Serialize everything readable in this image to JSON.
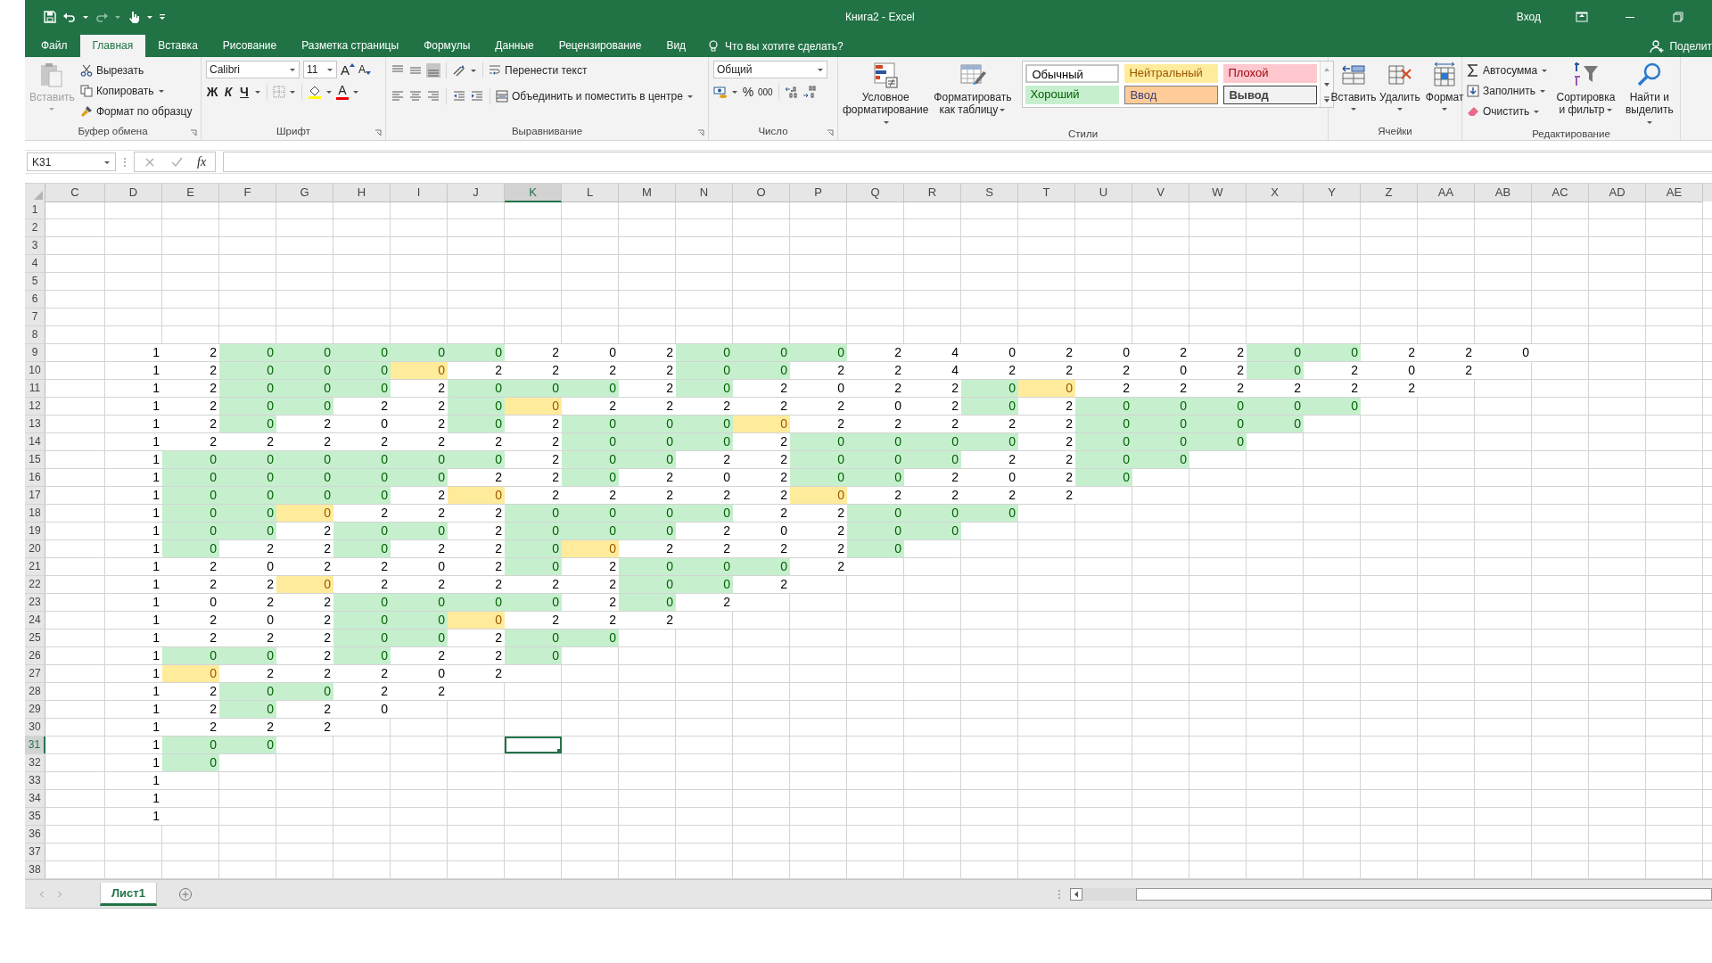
{
  "title_bar": {
    "title": "Книга2  -  Excel",
    "sign_in": "Вход"
  },
  "ribbon_tabs": [
    {
      "label": "Файл",
      "selected": false
    },
    {
      "label": "Главная",
      "selected": true
    },
    {
      "label": "Вставка",
      "selected": false
    },
    {
      "label": "Рисование",
      "selected": false
    },
    {
      "label": "Разметка страницы",
      "selected": false
    },
    {
      "label": "Формулы",
      "selected": false
    },
    {
      "label": "Данные",
      "selected": false
    },
    {
      "label": "Рецензирование",
      "selected": false
    },
    {
      "label": "Вид",
      "selected": false
    }
  ],
  "tell_me": "Что вы хотите сделать?",
  "share": "Поделит",
  "clipboard": {
    "paste": {
      "label": "Вставить",
      "disabled": true
    },
    "cut": "Вырезать",
    "copy": "Копировать",
    "format_painter": "Формат по образцу",
    "group_label": "Буфер обмена"
  },
  "font": {
    "name": "Calibri",
    "size": "11",
    "grow": "A",
    "shrink": "A",
    "bold": "Ж",
    "italic": "К",
    "underline": "Ч",
    "font_color_label": "A",
    "group_label": "Шрифт"
  },
  "alignment": {
    "wrap_text": "Перенести текст",
    "merge": "Объединить и поместить в центре",
    "group_label": "Выравнивание"
  },
  "number": {
    "format": "Общий",
    "percent": "%",
    "thousands": "000",
    "group_label": "Число"
  },
  "styles": {
    "conditional": "Условное форматирование",
    "format_table": "Форматировать как таблицу",
    "group_label": "Стили",
    "gallery": [
      {
        "label": "Обычный",
        "kind": "normal"
      },
      {
        "label": "Нейтральный",
        "kind": "neutral"
      },
      {
        "label": "Плохой",
        "kind": "bad"
      },
      {
        "label": "Хороший",
        "kind": "good"
      },
      {
        "label": "Ввод",
        "kind": "input"
      },
      {
        "label": "Вывод",
        "kind": "output"
      }
    ]
  },
  "cells_group": {
    "insert": "Вставить",
    "delete": "Удалить",
    "format": "Формат",
    "group_label": "Ячейки"
  },
  "editing": {
    "autosum": "Автосумма",
    "fill": "Заполнить",
    "clear": "Очистить",
    "sort_filter": "Сортировка и фильтр",
    "find_select": "Найти и выделить",
    "group_label": "Редактирование"
  },
  "formula_bar": {
    "name_box": "K31",
    "function_label": "fx"
  },
  "sheet": {
    "columns": [
      {
        "label": "C",
        "selected": false
      },
      {
        "label": "D",
        "selected": false
      },
      {
        "label": "E",
        "selected": false
      },
      {
        "label": "F",
        "selected": false
      },
      {
        "label": "G",
        "selected": false
      },
      {
        "label": "H",
        "selected": false
      },
      {
        "label": "I",
        "selected": false
      },
      {
        "label": "J",
        "selected": false
      },
      {
        "label": "K",
        "selected": true
      },
      {
        "label": "L",
        "selected": false
      },
      {
        "label": "M",
        "selected": false
      },
      {
        "label": "N",
        "selected": false
      },
      {
        "label": "O",
        "selected": false
      },
      {
        "label": "P",
        "selected": false
      },
      {
        "label": "Q",
        "selected": false
      },
      {
        "label": "R",
        "selected": false
      },
      {
        "label": "S",
        "selected": false
      },
      {
        "label": "T",
        "selected": false
      },
      {
        "label": "U",
        "selected": false
      },
      {
        "label": "V",
        "selected": false
      },
      {
        "label": "W",
        "selected": false
      },
      {
        "label": "X",
        "selected": false
      },
      {
        "label": "Y",
        "selected": false
      },
      {
        "label": "Z",
        "selected": false
      },
      {
        "label": "AA",
        "selected": false
      },
      {
        "label": "AB",
        "selected": false
      },
      {
        "label": "AC",
        "selected": false
      },
      {
        "label": "AD",
        "selected": false
      },
      {
        "label": "AE",
        "selected": false
      }
    ],
    "rows": [
      {
        "header": "1",
        "selected": false
      },
      {
        "header": "2",
        "selected": false
      },
      {
        "header": "3",
        "selected": false
      },
      {
        "header": "4",
        "selected": false
      },
      {
        "header": "5",
        "selected": false
      },
      {
        "header": "6",
        "selected": false
      },
      {
        "header": "7",
        "selected": false
      },
      {
        "header": "8",
        "selected": false
      },
      {
        "header": "9",
        "selected": false,
        "cells": [
          {
            "value": "1",
            "kind": "plain"
          },
          {
            "value": "2",
            "kind": "plain"
          },
          {
            "value": "0",
            "kind": "good"
          },
          {
            "value": "0",
            "kind": "good"
          },
          {
            "value": "0",
            "kind": "good"
          },
          {
            "value": "0",
            "kind": "good"
          },
          {
            "value": "0",
            "kind": "good"
          },
          {
            "value": "2",
            "kind": "plain"
          },
          {
            "value": "0",
            "kind": "plain"
          },
          {
            "value": "2",
            "kind": "plain"
          },
          {
            "value": "0",
            "kind": "good"
          },
          {
            "value": "0",
            "kind": "good"
          },
          {
            "value": "0",
            "kind": "good"
          },
          {
            "value": "2",
            "kind": "plain"
          },
          {
            "value": "4",
            "kind": "plain"
          },
          {
            "value": "0",
            "kind": "plain"
          },
          {
            "value": "2",
            "kind": "plain"
          },
          {
            "value": "0",
            "kind": "plain"
          },
          {
            "value": "2",
            "kind": "plain"
          },
          {
            "value": "2",
            "kind": "plain"
          },
          {
            "value": "0",
            "kind": "good"
          },
          {
            "value": "0",
            "kind": "good"
          },
          {
            "value": "2",
            "kind": "plain"
          },
          {
            "value": "2",
            "kind": "plain"
          },
          {
            "value": "0",
            "kind": "plain"
          }
        ]
      },
      {
        "header": "10",
        "selected": false,
        "cells": [
          {
            "value": "1",
            "kind": "plain"
          },
          {
            "value": "2",
            "kind": "plain"
          },
          {
            "value": "0",
            "kind": "good"
          },
          {
            "value": "0",
            "kind": "good"
          },
          {
            "value": "0",
            "kind": "good"
          },
          {
            "value": "0",
            "kind": "neutral"
          },
          {
            "value": "2",
            "kind": "plain"
          },
          {
            "value": "2",
            "kind": "plain"
          },
          {
            "value": "2",
            "kind": "plain"
          },
          {
            "value": "2",
            "kind": "plain"
          },
          {
            "value": "0",
            "kind": "good"
          },
          {
            "value": "0",
            "kind": "good"
          },
          {
            "value": "2",
            "kind": "plain"
          },
          {
            "value": "2",
            "kind": "plain"
          },
          {
            "value": "4",
            "kind": "plain"
          },
          {
            "value": "2",
            "kind": "plain"
          },
          {
            "value": "2",
            "kind": "plain"
          },
          {
            "value": "2",
            "kind": "plain"
          },
          {
            "value": "0",
            "kind": "plain"
          },
          {
            "value": "2",
            "kind": "plain"
          },
          {
            "value": "0",
            "kind": "good"
          },
          {
            "value": "2",
            "kind": "plain"
          },
          {
            "value": "0",
            "kind": "plain"
          },
          {
            "value": "2",
            "kind": "plain"
          }
        ]
      },
      {
        "header": "11",
        "selected": false,
        "cells": [
          {
            "value": "1",
            "kind": "plain"
          },
          {
            "value": "2",
            "kind": "plain"
          },
          {
            "value": "0",
            "kind": "good"
          },
          {
            "value": "0",
            "kind": "good"
          },
          {
            "value": "0",
            "kind": "good"
          },
          {
            "value": "2",
            "kind": "plain"
          },
          {
            "value": "0",
            "kind": "good"
          },
          {
            "value": "0",
            "kind": "good"
          },
          {
            "value": "0",
            "kind": "good"
          },
          {
            "value": "2",
            "kind": "plain"
          },
          {
            "value": "0",
            "kind": "good"
          },
          {
            "value": "2",
            "kind": "plain"
          },
          {
            "value": "0",
            "kind": "plain"
          },
          {
            "value": "2",
            "kind": "plain"
          },
          {
            "value": "2",
            "kind": "plain"
          },
          {
            "value": "0",
            "kind": "good"
          },
          {
            "value": "0",
            "kind": "neutral"
          },
          {
            "value": "2",
            "kind": "plain"
          },
          {
            "value": "2",
            "kind": "plain"
          },
          {
            "value": "2",
            "kind": "plain"
          },
          {
            "value": "2",
            "kind": "plain"
          },
          {
            "value": "2",
            "kind": "plain"
          },
          {
            "value": "2",
            "kind": "plain"
          }
        ]
      },
      {
        "header": "12",
        "selected": false,
        "cells": [
          {
            "value": "1",
            "kind": "plain"
          },
          {
            "value": "2",
            "kind": "plain"
          },
          {
            "value": "0",
            "kind": "good"
          },
          {
            "value": "0",
            "kind": "good"
          },
          {
            "value": "2",
            "kind": "plain"
          },
          {
            "value": "2",
            "kind": "plain"
          },
          {
            "value": "0",
            "kind": "good"
          },
          {
            "value": "0",
            "kind": "neutral"
          },
          {
            "value": "2",
            "kind": "plain"
          },
          {
            "value": "2",
            "kind": "plain"
          },
          {
            "value": "2",
            "kind": "plain"
          },
          {
            "value": "2",
            "kind": "plain"
          },
          {
            "value": "2",
            "kind": "plain"
          },
          {
            "value": "0",
            "kind": "plain"
          },
          {
            "value": "2",
            "kind": "plain"
          },
          {
            "value": "0",
            "kind": "good"
          },
          {
            "value": "2",
            "kind": "plain"
          },
          {
            "value": "0",
            "kind": "good"
          },
          {
            "value": "0",
            "kind": "good"
          },
          {
            "value": "0",
            "kind": "good"
          },
          {
            "value": "0",
            "kind": "good"
          },
          {
            "value": "0",
            "kind": "good"
          }
        ]
      },
      {
        "header": "13",
        "selected": false,
        "cells": [
          {
            "value": "1",
            "kind": "plain"
          },
          {
            "value": "2",
            "kind": "plain"
          },
          {
            "value": "0",
            "kind": "good"
          },
          {
            "value": "2",
            "kind": "plain"
          },
          {
            "value": "0",
            "kind": "plain"
          },
          {
            "value": "2",
            "kind": "plain"
          },
          {
            "value": "0",
            "kind": "good"
          },
          {
            "value": "2",
            "kind": "plain"
          },
          {
            "value": "0",
            "kind": "good"
          },
          {
            "value": "0",
            "kind": "good"
          },
          {
            "value": "0",
            "kind": "good"
          },
          {
            "value": "0",
            "kind": "neutral"
          },
          {
            "value": "2",
            "kind": "plain"
          },
          {
            "value": "2",
            "kind": "plain"
          },
          {
            "value": "2",
            "kind": "plain"
          },
          {
            "value": "2",
            "kind": "plain"
          },
          {
            "value": "2",
            "kind": "plain"
          },
          {
            "value": "0",
            "kind": "good"
          },
          {
            "value": "0",
            "kind": "good"
          },
          {
            "value": "0",
            "kind": "good"
          },
          {
            "value": "0",
            "kind": "good"
          }
        ]
      },
      {
        "header": "14",
        "selected": false,
        "cells": [
          {
            "value": "1",
            "kind": "plain"
          },
          {
            "value": "2",
            "kind": "plain"
          },
          {
            "value": "2",
            "kind": "plain"
          },
          {
            "value": "2",
            "kind": "plain"
          },
          {
            "value": "2",
            "kind": "plain"
          },
          {
            "value": "2",
            "kind": "plain"
          },
          {
            "value": "2",
            "kind": "plain"
          },
          {
            "value": "2",
            "kind": "plain"
          },
          {
            "value": "0",
            "kind": "good"
          },
          {
            "value": "0",
            "kind": "good"
          },
          {
            "value": "0",
            "kind": "good"
          },
          {
            "value": "2",
            "kind": "plain"
          },
          {
            "value": "0",
            "kind": "good"
          },
          {
            "value": "0",
            "kind": "good"
          },
          {
            "value": "0",
            "kind": "good"
          },
          {
            "value": "0",
            "kind": "good"
          },
          {
            "value": "2",
            "kind": "plain"
          },
          {
            "value": "0",
            "kind": "good"
          },
          {
            "value": "0",
            "kind": "good"
          },
          {
            "value": "0",
            "kind": "good"
          }
        ]
      },
      {
        "header": "15",
        "selected": false,
        "cells": [
          {
            "value": "1",
            "kind": "plain"
          },
          {
            "value": "0",
            "kind": "good"
          },
          {
            "value": "0",
            "kind": "good"
          },
          {
            "value": "0",
            "kind": "good"
          },
          {
            "value": "0",
            "kind": "good"
          },
          {
            "value": "0",
            "kind": "good"
          },
          {
            "value": "0",
            "kind": "good"
          },
          {
            "value": "2",
            "kind": "plain"
          },
          {
            "value": "0",
            "kind": "good"
          },
          {
            "value": "0",
            "kind": "good"
          },
          {
            "value": "2",
            "kind": "plain"
          },
          {
            "value": "2",
            "kind": "plain"
          },
          {
            "value": "0",
            "kind": "good"
          },
          {
            "value": "0",
            "kind": "good"
          },
          {
            "value": "0",
            "kind": "good"
          },
          {
            "value": "2",
            "kind": "plain"
          },
          {
            "value": "2",
            "kind": "plain"
          },
          {
            "value": "0",
            "kind": "good"
          },
          {
            "value": "0",
            "kind": "good"
          }
        ]
      },
      {
        "header": "16",
        "selected": false,
        "cells": [
          {
            "value": "1",
            "kind": "plain"
          },
          {
            "value": "0",
            "kind": "good"
          },
          {
            "value": "0",
            "kind": "good"
          },
          {
            "value": "0",
            "kind": "good"
          },
          {
            "value": "0",
            "kind": "good"
          },
          {
            "value": "0",
            "kind": "good"
          },
          {
            "value": "2",
            "kind": "plain"
          },
          {
            "value": "2",
            "kind": "plain"
          },
          {
            "value": "0",
            "kind": "good"
          },
          {
            "value": "2",
            "kind": "plain"
          },
          {
            "value": "0",
            "kind": "plain"
          },
          {
            "value": "2",
            "kind": "plain"
          },
          {
            "value": "0",
            "kind": "good"
          },
          {
            "value": "0",
            "kind": "good"
          },
          {
            "value": "2",
            "kind": "plain"
          },
          {
            "value": "0",
            "kind": "plain"
          },
          {
            "value": "2",
            "kind": "plain"
          },
          {
            "value": "0",
            "kind": "good"
          }
        ]
      },
      {
        "header": "17",
        "selected": false,
        "cells": [
          {
            "value": "1",
            "kind": "plain"
          },
          {
            "value": "0",
            "kind": "good"
          },
          {
            "value": "0",
            "kind": "good"
          },
          {
            "value": "0",
            "kind": "good"
          },
          {
            "value": "0",
            "kind": "good"
          },
          {
            "value": "2",
            "kind": "plain"
          },
          {
            "value": "0",
            "kind": "neutral"
          },
          {
            "value": "2",
            "kind": "plain"
          },
          {
            "value": "2",
            "kind": "plain"
          },
          {
            "value": "2",
            "kind": "plain"
          },
          {
            "value": "2",
            "kind": "plain"
          },
          {
            "value": "2",
            "kind": "plain"
          },
          {
            "value": "0",
            "kind": "neutral"
          },
          {
            "value": "2",
            "kind": "plain"
          },
          {
            "value": "2",
            "kind": "plain"
          },
          {
            "value": "2",
            "kind": "plain"
          },
          {
            "value": "2",
            "kind": "plain"
          }
        ]
      },
      {
        "header": "18",
        "selected": false,
        "cells": [
          {
            "value": "1",
            "kind": "plain"
          },
          {
            "value": "0",
            "kind": "good"
          },
          {
            "value": "0",
            "kind": "good"
          },
          {
            "value": "0",
            "kind": "neutral"
          },
          {
            "value": "2",
            "kind": "plain"
          },
          {
            "value": "2",
            "kind": "plain"
          },
          {
            "value": "2",
            "kind": "plain"
          },
          {
            "value": "0",
            "kind": "good"
          },
          {
            "value": "0",
            "kind": "good"
          },
          {
            "value": "0",
            "kind": "good"
          },
          {
            "value": "0",
            "kind": "good"
          },
          {
            "value": "2",
            "kind": "plain"
          },
          {
            "value": "2",
            "kind": "plain"
          },
          {
            "value": "0",
            "kind": "good"
          },
          {
            "value": "0",
            "kind": "good"
          },
          {
            "value": "0",
            "kind": "good"
          }
        ]
      },
      {
        "header": "19",
        "selected": false,
        "cells": [
          {
            "value": "1",
            "kind": "plain"
          },
          {
            "value": "0",
            "kind": "good"
          },
          {
            "value": "0",
            "kind": "good"
          },
          {
            "value": "2",
            "kind": "plain"
          },
          {
            "value": "0",
            "kind": "good"
          },
          {
            "value": "0",
            "kind": "good"
          },
          {
            "value": "2",
            "kind": "plain"
          },
          {
            "value": "0",
            "kind": "good"
          },
          {
            "value": "0",
            "kind": "good"
          },
          {
            "value": "0",
            "kind": "good"
          },
          {
            "value": "2",
            "kind": "plain"
          },
          {
            "value": "0",
            "kind": "plain"
          },
          {
            "value": "2",
            "kind": "plain"
          },
          {
            "value": "0",
            "kind": "good"
          },
          {
            "value": "0",
            "kind": "good"
          }
        ]
      },
      {
        "header": "20",
        "selected": false,
        "cells": [
          {
            "value": "1",
            "kind": "plain"
          },
          {
            "value": "0",
            "kind": "good"
          },
          {
            "value": "2",
            "kind": "plain"
          },
          {
            "value": "2",
            "kind": "plain"
          },
          {
            "value": "0",
            "kind": "good"
          },
          {
            "value": "2",
            "kind": "plain"
          },
          {
            "value": "2",
            "kind": "plain"
          },
          {
            "value": "0",
            "kind": "good"
          },
          {
            "value": "0",
            "kind": "neutral"
          },
          {
            "value": "2",
            "kind": "plain"
          },
          {
            "value": "2",
            "kind": "plain"
          },
          {
            "value": "2",
            "kind": "plain"
          },
          {
            "value": "2",
            "kind": "plain"
          },
          {
            "value": "0",
            "kind": "good"
          }
        ]
      },
      {
        "header": "21",
        "selected": false,
        "cells": [
          {
            "value": "1",
            "kind": "plain"
          },
          {
            "value": "2",
            "kind": "plain"
          },
          {
            "value": "0",
            "kind": "plain"
          },
          {
            "value": "2",
            "kind": "plain"
          },
          {
            "value": "2",
            "kind": "plain"
          },
          {
            "value": "0",
            "kind": "plain"
          },
          {
            "value": "2",
            "kind": "plain"
          },
          {
            "value": "0",
            "kind": "good"
          },
          {
            "value": "2",
            "kind": "plain"
          },
          {
            "value": "0",
            "kind": "good"
          },
          {
            "value": "0",
            "kind": "good"
          },
          {
            "value": "0",
            "kind": "good"
          },
          {
            "value": "2",
            "kind": "plain"
          }
        ]
      },
      {
        "header": "22",
        "selected": false,
        "cells": [
          {
            "value": "1",
            "kind": "plain"
          },
          {
            "value": "2",
            "kind": "plain"
          },
          {
            "value": "2",
            "kind": "plain"
          },
          {
            "value": "0",
            "kind": "neutral"
          },
          {
            "value": "2",
            "kind": "plain"
          },
          {
            "value": "2",
            "kind": "plain"
          },
          {
            "value": "2",
            "kind": "plain"
          },
          {
            "value": "2",
            "kind": "plain"
          },
          {
            "value": "2",
            "kind": "plain"
          },
          {
            "value": "0",
            "kind": "good"
          },
          {
            "value": "0",
            "kind": "good"
          },
          {
            "value": "2",
            "kind": "plain"
          }
        ]
      },
      {
        "header": "23",
        "selected": false,
        "cells": [
          {
            "value": "1",
            "kind": "plain"
          },
          {
            "value": "0",
            "kind": "plain"
          },
          {
            "value": "2",
            "kind": "plain"
          },
          {
            "value": "2",
            "kind": "plain"
          },
          {
            "value": "0",
            "kind": "good"
          },
          {
            "value": "0",
            "kind": "good"
          },
          {
            "value": "0",
            "kind": "good"
          },
          {
            "value": "0",
            "kind": "good"
          },
          {
            "value": "2",
            "kind": "plain"
          },
          {
            "value": "0",
            "kind": "good"
          },
          {
            "value": "2",
            "kind": "plain"
          }
        ]
      },
      {
        "header": "24",
        "selected": false,
        "cells": [
          {
            "value": "1",
            "kind": "plain"
          },
          {
            "value": "2",
            "kind": "plain"
          },
          {
            "value": "0",
            "kind": "plain"
          },
          {
            "value": "2",
            "kind": "plain"
          },
          {
            "value": "0",
            "kind": "good"
          },
          {
            "value": "0",
            "kind": "good"
          },
          {
            "value": "0",
            "kind": "neutral"
          },
          {
            "value": "2",
            "kind": "plain"
          },
          {
            "value": "2",
            "kind": "plain"
          },
          {
            "value": "2",
            "kind": "plain"
          }
        ]
      },
      {
        "header": "25",
        "selected": false,
        "cells": [
          {
            "value": "1",
            "kind": "plain"
          },
          {
            "value": "2",
            "kind": "plain"
          },
          {
            "value": "2",
            "kind": "plain"
          },
          {
            "value": "2",
            "kind": "plain"
          },
          {
            "value": "0",
            "kind": "good"
          },
          {
            "value": "0",
            "kind": "good"
          },
          {
            "value": "2",
            "kind": "plain"
          },
          {
            "value": "0",
            "kind": "good"
          },
          {
            "value": "0",
            "kind": "good"
          }
        ]
      },
      {
        "header": "26",
        "selected": false,
        "cells": [
          {
            "value": "1",
            "kind": "plain"
          },
          {
            "value": "0",
            "kind": "good"
          },
          {
            "value": "0",
            "kind": "good"
          },
          {
            "value": "2",
            "kind": "plain"
          },
          {
            "value": "0",
            "kind": "good"
          },
          {
            "value": "2",
            "kind": "plain"
          },
          {
            "value": "2",
            "kind": "plain"
          },
          {
            "value": "0",
            "kind": "good"
          }
        ]
      },
      {
        "header": "27",
        "selected": false,
        "cells": [
          {
            "value": "1",
            "kind": "plain"
          },
          {
            "value": "0",
            "kind": "neutral"
          },
          {
            "value": "2",
            "kind": "plain"
          },
          {
            "value": "2",
            "kind": "plain"
          },
          {
            "value": "2",
            "kind": "plain"
          },
          {
            "value": "0",
            "kind": "plain"
          },
          {
            "value": "2",
            "kind": "plain"
          }
        ]
      },
      {
        "header": "28",
        "selected": false,
        "cells": [
          {
            "value": "1",
            "kind": "plain"
          },
          {
            "value": "2",
            "kind": "plain"
          },
          {
            "value": "0",
            "kind": "good"
          },
          {
            "value": "0",
            "kind": "good"
          },
          {
            "value": "2",
            "kind": "plain"
          },
          {
            "value": "2",
            "kind": "plain"
          }
        ]
      },
      {
        "header": "29",
        "selected": false,
        "cells": [
          {
            "value": "1",
            "kind": "plain"
          },
          {
            "value": "2",
            "kind": "plain"
          },
          {
            "value": "0",
            "kind": "good"
          },
          {
            "value": "2",
            "kind": "plain"
          },
          {
            "value": "0",
            "kind": "plain"
          }
        ]
      },
      {
        "header": "30",
        "selected": false,
        "cells": [
          {
            "value": "1",
            "kind": "plain"
          },
          {
            "value": "2",
            "kind": "plain"
          },
          {
            "value": "2",
            "kind": "plain"
          },
          {
            "value": "2",
            "kind": "plain"
          }
        ]
      },
      {
        "header": "31",
        "selected": true,
        "cells": [
          {
            "value": "1",
            "kind": "plain"
          },
          {
            "value": "0",
            "kind": "good"
          },
          {
            "value": "0",
            "kind": "good"
          }
        ]
      },
      {
        "header": "32",
        "selected": false,
        "cells": [
          {
            "value": "1",
            "kind": "plain"
          },
          {
            "value": "0",
            "kind": "good"
          }
        ]
      },
      {
        "header": "33",
        "selected": false,
        "cells": [
          {
            "value": "1",
            "kind": "plain"
          }
        ]
      },
      {
        "header": "34",
        "selected": false,
        "cells": [
          {
            "value": "1",
            "kind": "plain"
          }
        ]
      },
      {
        "header": "35",
        "selected": false,
        "cells": [
          {
            "value": "1",
            "kind": "plain"
          }
        ]
      },
      {
        "header": "36",
        "selected": false
      },
      {
        "header": "37",
        "selected": false
      },
      {
        "header": "38",
        "selected": false
      }
    ]
  },
  "sheet_tabs": [
    {
      "label": "Лист1",
      "selected": true
    }
  ]
}
